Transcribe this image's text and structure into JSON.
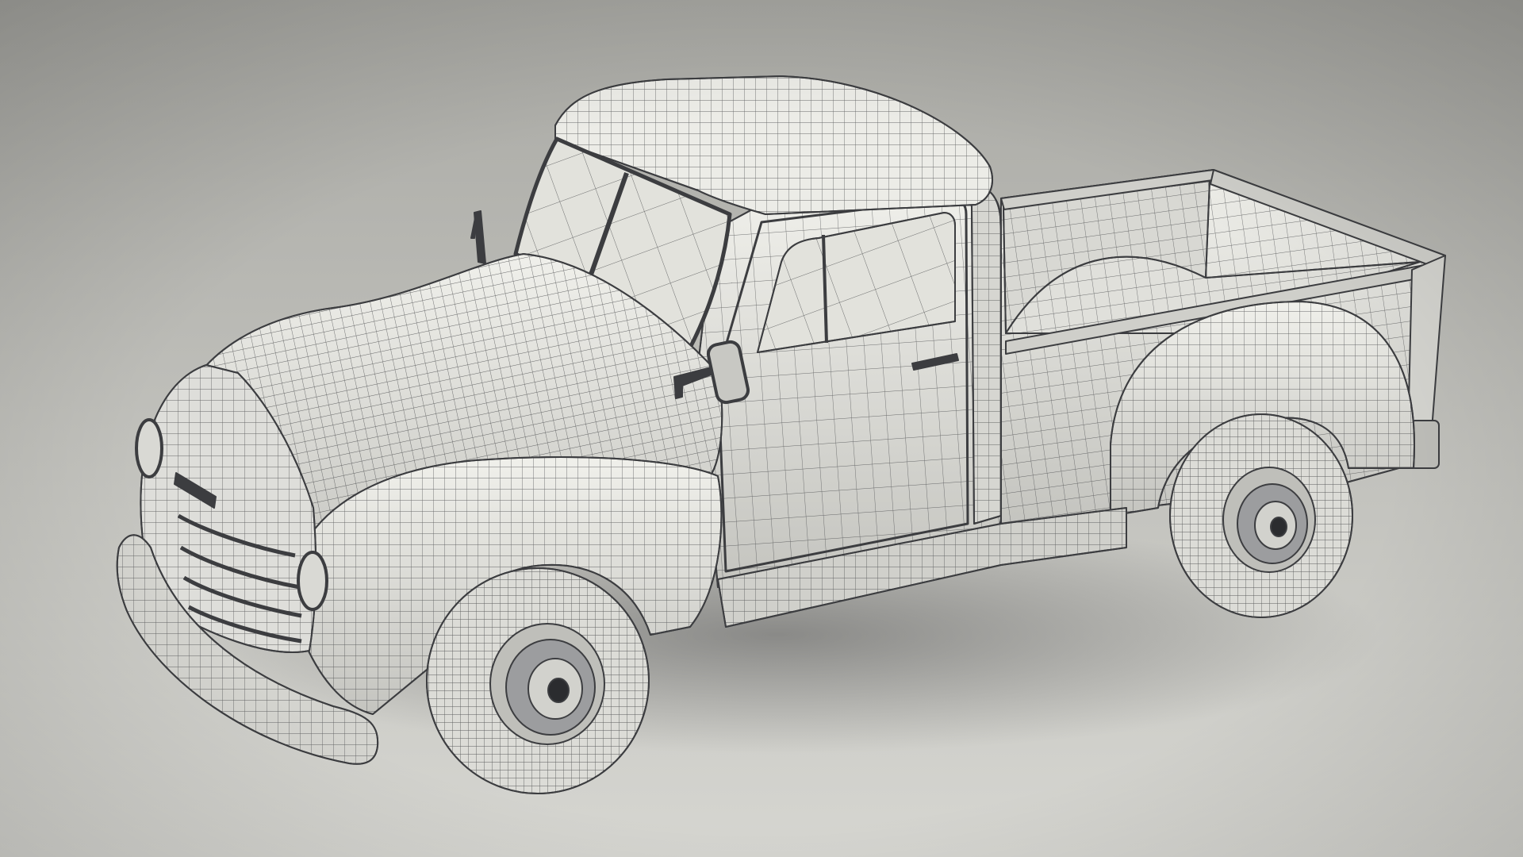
{
  "scene": {
    "subject": "vintage-pickup-truck",
    "render_style": "wireframe-clay",
    "colors": {
      "background_top": "#a9a9a4",
      "background_bottom": "#d6d6d1",
      "body": "#e7e7e2",
      "body_shade": "#c8c8c3",
      "wire": "#3c3d40",
      "glass": "#e2e2dc",
      "tire": "#dcdcd7",
      "hub": "#4a4b4e",
      "shadow": "#8e8e89"
    }
  }
}
